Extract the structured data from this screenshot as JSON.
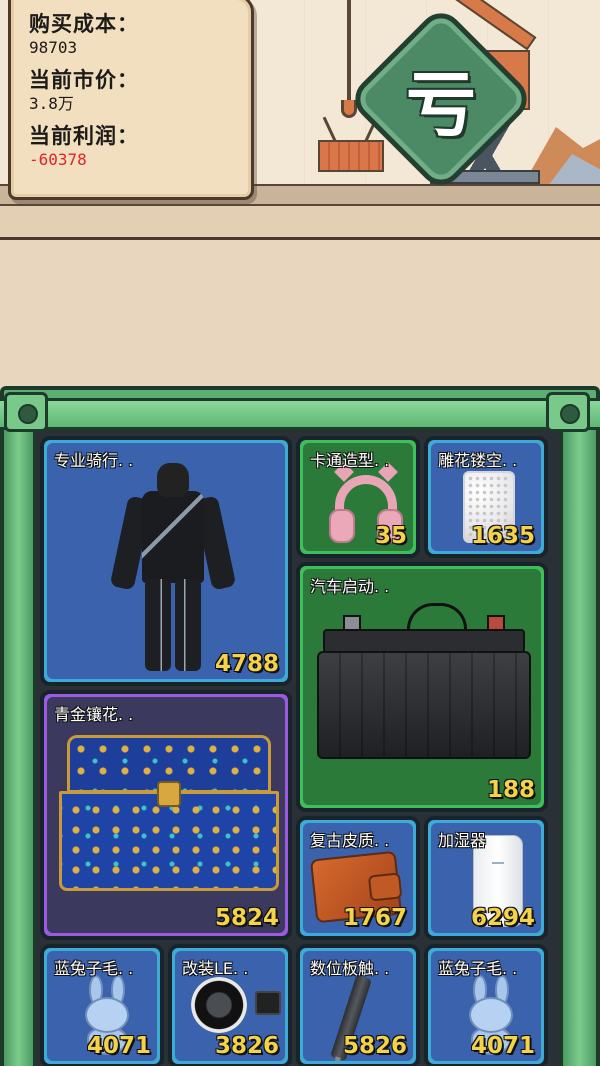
{
  "info": {
    "cost_label": "购买成本：",
    "cost_value": "98703",
    "market_label": "当前市价：",
    "market_value": "3.8万",
    "profit_label": "当前利润：",
    "profit_value": "-60378"
  },
  "badge": {
    "text": "亏"
  },
  "colors": {
    "profit_negative": "#e0242a",
    "price_text": "#f4d34a",
    "rarity_blue": "#3eaad6",
    "rarity_green": "#3fbf5b",
    "rarity_purple": "#9b5ae0",
    "panel_green": "#5cae72"
  },
  "items": [
    {
      "name": "专业骑行. .",
      "price": "4788",
      "rarity": "blue",
      "icon": "motorcycle-suit-icon"
    },
    {
      "name": "卡通造型. .",
      "price": "35",
      "rarity": "green",
      "icon": "headphones-icon"
    },
    {
      "name": "雕花镂空. .",
      "price": "1635",
      "rarity": "blue",
      "icon": "lamp-icon"
    },
    {
      "name": "汽车启动. .",
      "price": "188",
      "rarity": "green",
      "icon": "car-battery-icon"
    },
    {
      "name": "青金镶花. .",
      "price": "5824",
      "rarity": "purple",
      "icon": "jewel-chest-icon"
    },
    {
      "name": "复古皮质. .",
      "price": "1767",
      "rarity": "blue",
      "icon": "wallet-icon"
    },
    {
      "name": "加湿器",
      "price": "6294",
      "rarity": "blue",
      "icon": "humidifier-icon"
    },
    {
      "name": "蓝兔子毛. .",
      "price": "4071",
      "rarity": "blue",
      "icon": "bunny-plush-icon"
    },
    {
      "name": "改装LE. .",
      "price": "3826",
      "rarity": "blue",
      "icon": "led-light-icon"
    },
    {
      "name": "数位板触. .",
      "price": "5826",
      "rarity": "blue",
      "icon": "stylus-pen-icon"
    },
    {
      "name": "蓝兔子毛. .",
      "price": "4071",
      "rarity": "blue",
      "icon": "bunny-plush-icon"
    }
  ]
}
